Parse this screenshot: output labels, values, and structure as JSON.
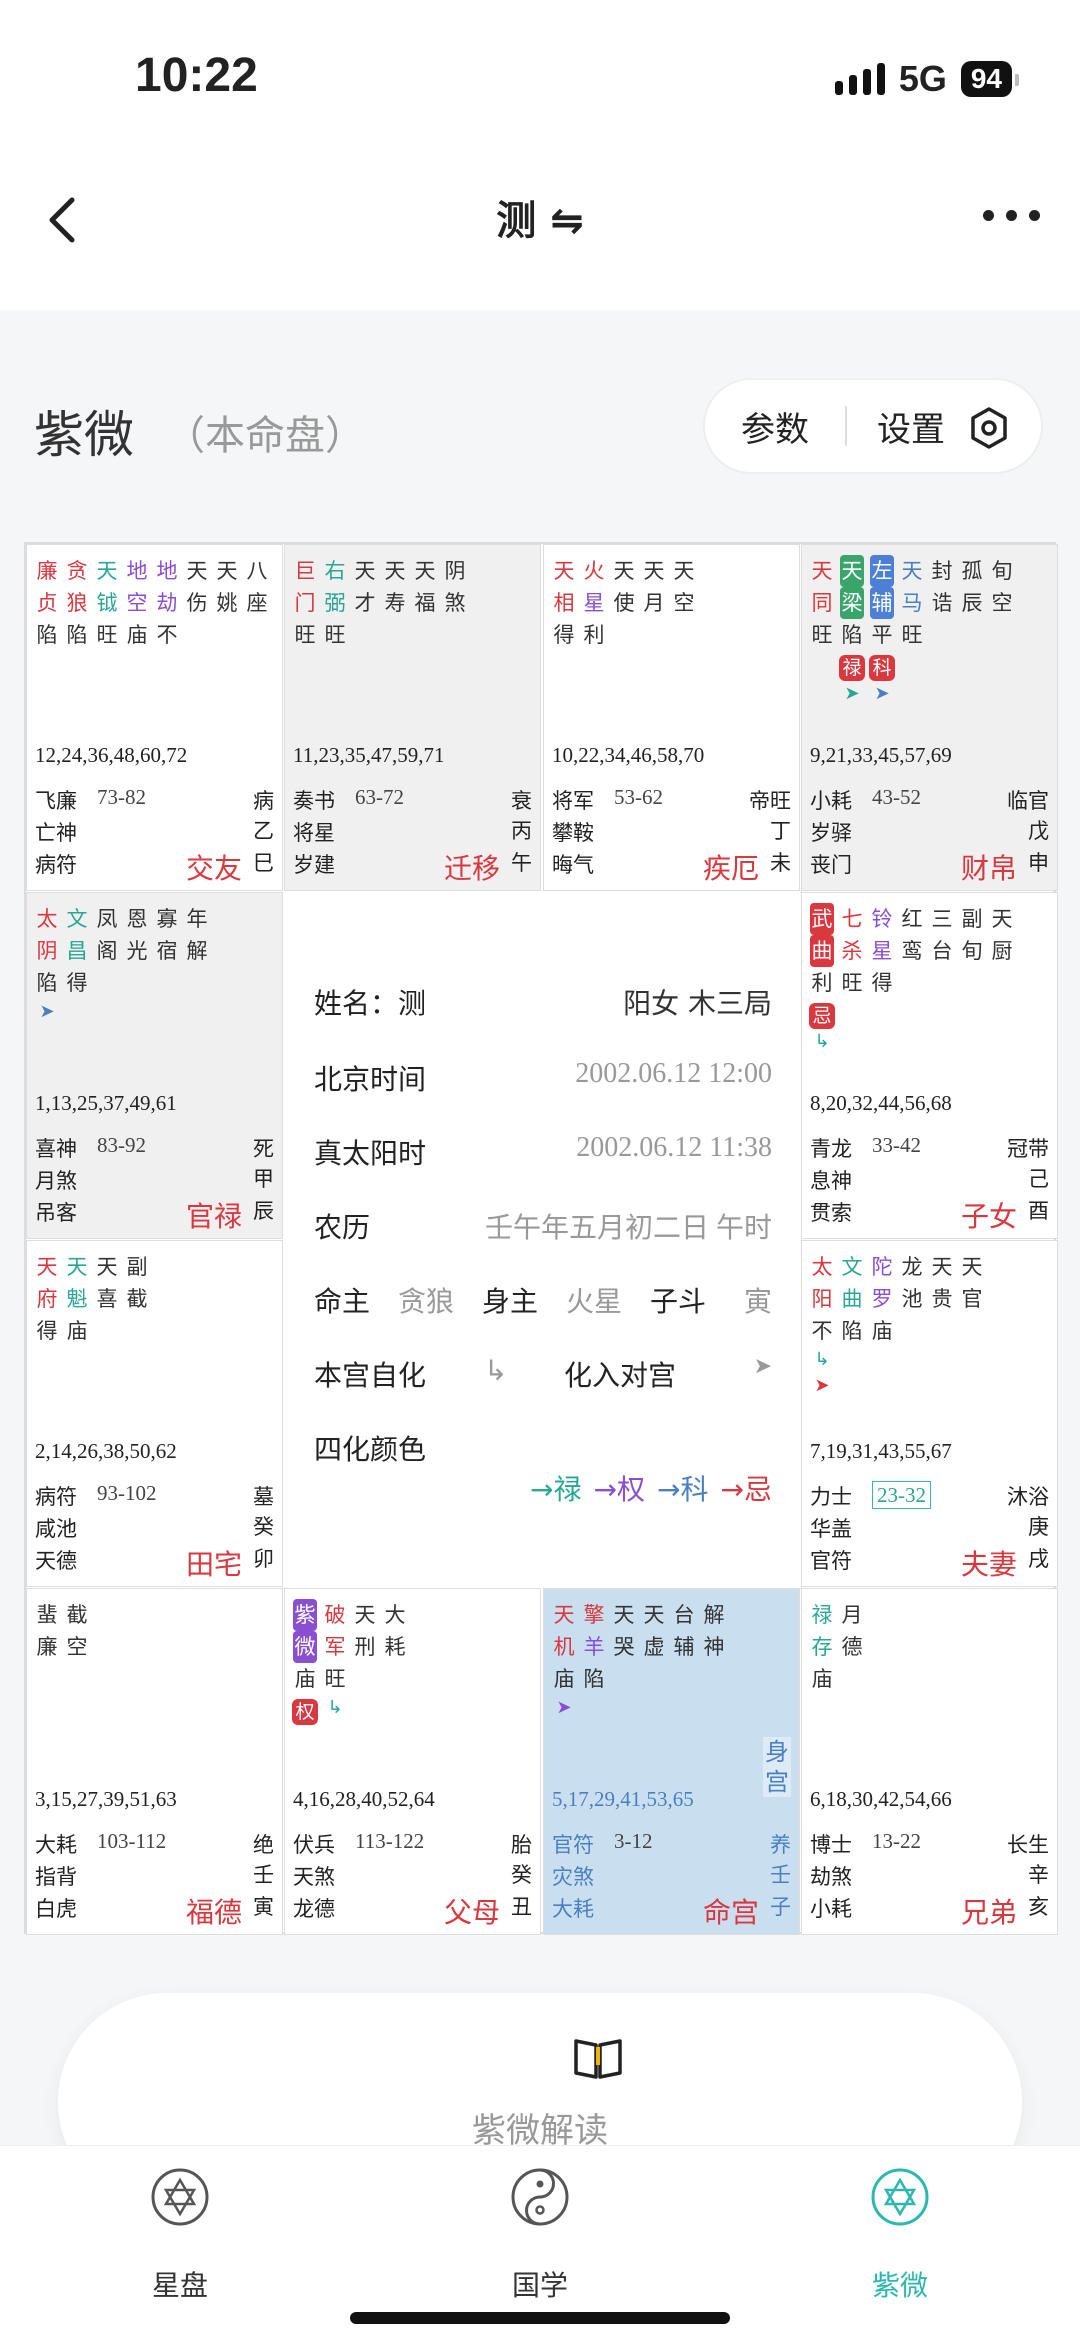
{
  "status": {
    "time": "10:22",
    "network": "5G",
    "battery": "94"
  },
  "nav": {
    "title": "测 ⇋"
  },
  "header": {
    "title": "紫微",
    "subtitle": "（本命盘）",
    "params_label": "参数",
    "settings_label": "设置"
  },
  "center": {
    "name_label": "姓名：测",
    "gender_ju": "阳女 木三局",
    "beijing_label": "北京时间",
    "beijing_value": "2002.06.12 12:00",
    "solar_label": "真太阳时",
    "solar_value": "2002.06.12 11:38",
    "lunar_label": "农历",
    "lunar_value": "壬午年五月初二日 午时",
    "ming_zhu_label": "命主",
    "ming_zhu_value": "贪狼",
    "shen_zhu_label": "身主",
    "shen_zhu_value": "火星",
    "zi_dou_label": "子斗",
    "zi_dou_value": "寅",
    "self_hua_label": "本宫自化",
    "self_hua_icon": "↳",
    "opp_hua_label": "化入对宫",
    "opp_hua_icon": "➤",
    "color_label": "四化颜色",
    "lu": "→禄",
    "quan": "→权",
    "ke": "→科",
    "ji": "→忌"
  },
  "palaces": [
    {
      "id": "si",
      "ages": "12,24,36,48,60,72",
      "l1": "飞廉",
      "range": "73-82",
      "r1": "病",
      "l2": "亡神",
      "r2": "乙",
      "l3": "病符",
      "name": "交友",
      "r3": "巳",
      "stars": [
        {
          "t": [
            "廉",
            "贞",
            "陷"
          ],
          "c": [
            "red",
            "red",
            "dark"
          ]
        },
        {
          "t": [
            "贪",
            "狼",
            "陷"
          ],
          "c": [
            "red",
            "red",
            "dark"
          ]
        },
        {
          "t": [
            "天",
            "钺",
            "旺"
          ],
          "c": [
            "green",
            "green",
            "dark"
          ]
        },
        {
          "t": [
            "地",
            "空",
            "庙"
          ],
          "c": [
            "purple",
            "purple",
            "dark"
          ]
        },
        {
          "t": [
            "地",
            "劫",
            "不"
          ],
          "c": [
            "purple",
            "purple",
            "dark"
          ]
        },
        {
          "t": [
            "天",
            "伤"
          ],
          "c": [
            "dark",
            "dark"
          ]
        },
        {
          "t": [
            "天",
            "姚"
          ],
          "c": [
            "dark",
            "dark"
          ]
        },
        {
          "t": [
            "八",
            "座"
          ],
          "c": [
            "dark",
            "dark"
          ]
        }
      ]
    },
    {
      "id": "wu",
      "ages": "11,23,35,47,59,71",
      "l1": "奏书",
      "range": "63-72",
      "r1": "衰",
      "l2": "将星",
      "r2": "丙",
      "l3": "岁建",
      "name": "迁移",
      "r3": "午",
      "stars": [
        {
          "t": [
            "巨",
            "门",
            "旺"
          ],
          "c": [
            "red",
            "red",
            "dark"
          ]
        },
        {
          "t": [
            "右",
            "弼",
            "旺"
          ],
          "c": [
            "green",
            "green",
            "dark"
          ]
        },
        {
          "t": [
            "天",
            "才"
          ],
          "c": [
            "dark",
            "dark"
          ]
        },
        {
          "t": [
            "天",
            "寿"
          ],
          "c": [
            "dark",
            "dark"
          ]
        },
        {
          "t": [
            "天",
            "福"
          ],
          "c": [
            "dark",
            "dark"
          ]
        },
        {
          "t": [
            "阴",
            "煞"
          ],
          "c": [
            "dark",
            "dark"
          ]
        }
      ]
    },
    {
      "id": "wei",
      "ages": "10,22,34,46,58,70",
      "l1": "将军",
      "range": "53-62",
      "r1": "帝旺",
      "l2": "攀鞍",
      "r2": "丁",
      "l3": "晦气",
      "name": "疾厄",
      "r3": "未",
      "stars": [
        {
          "t": [
            "天",
            "相",
            "得"
          ],
          "c": [
            "red",
            "red",
            "dark"
          ]
        },
        {
          "t": [
            "火",
            "星",
            "利"
          ],
          "c": [
            "red",
            "purple",
            "dark"
          ]
        },
        {
          "t": [
            "天",
            "使"
          ],
          "c": [
            "dark",
            "dark"
          ]
        },
        {
          "t": [
            "天",
            "月"
          ],
          "c": [
            "dark",
            "dark"
          ]
        },
        {
          "t": [
            "天",
            "空"
          ],
          "c": [
            "dark",
            "dark"
          ]
        }
      ]
    },
    {
      "id": "shen",
      "ages": "9,21,33,45,57,69",
      "l1": "小耗",
      "range": "43-52",
      "r1": "临官",
      "l2": "岁驿",
      "r2": "戊",
      "l3": "丧门",
      "name": "财帛",
      "r3": "申",
      "stars": [
        {
          "t": [
            "天",
            "同",
            "旺"
          ],
          "c": [
            "red",
            "red",
            "dark"
          ]
        },
        {
          "t": [
            "天",
            "梁",
            "陷"
          ],
          "c": [
            "box-green",
            "box-green",
            "dark"
          ],
          "hua": "禄",
          "arrow": "➤",
          "arrowc": "green"
        },
        {
          "t": [
            "左",
            "辅",
            "平"
          ],
          "c": [
            "box-blue",
            "box-blue",
            "dark"
          ],
          "hua": "科",
          "arrow": "➤",
          "arrowc": "blue"
        },
        {
          "t": [
            "天",
            "马",
            "旺"
          ],
          "c": [
            "blue",
            "blue",
            "dark"
          ]
        },
        {
          "t": [
            "封",
            "诰"
          ],
          "c": [
            "dark",
            "dark"
          ]
        },
        {
          "t": [
            "孤",
            "辰"
          ],
          "c": [
            "dark",
            "dark"
          ]
        },
        {
          "t": [
            "旬",
            "空"
          ],
          "c": [
            "dark",
            "dark"
          ]
        }
      ]
    },
    {
      "id": "chen",
      "ages": "1,13,25,37,49,61",
      "l1": "喜神",
      "range": "83-92",
      "r1": "死",
      "l2": "月煞",
      "r2": "甲",
      "l3": "吊客",
      "name": "官禄",
      "r3": "辰",
      "stars": [
        {
          "t": [
            "太",
            "阴",
            "陷"
          ],
          "c": [
            "red",
            "red",
            "dark"
          ],
          "arrow": "➤",
          "arrowc": "blue"
        },
        {
          "t": [
            "文",
            "昌",
            "得"
          ],
          "c": [
            "green",
            "green",
            "dark"
          ]
        },
        {
          "t": [
            "凤",
            "阁"
          ],
          "c": [
            "dark",
            "dark"
          ]
        },
        {
          "t": [
            "恩",
            "光"
          ],
          "c": [
            "dark",
            "dark"
          ]
        },
        {
          "t": [
            "寡",
            "宿"
          ],
          "c": [
            "dark",
            "dark"
          ]
        },
        {
          "t": [
            "年",
            "解"
          ],
          "c": [
            "dark",
            "dark"
          ]
        }
      ]
    },
    {
      "id": "you",
      "ages": "8,20,32,44,56,68",
      "l1": "青龙",
      "range": "33-42",
      "r1": "冠带",
      "l2": "息神",
      "r2": "己",
      "l3": "贯索",
      "name": "子女",
      "r3": "酉",
      "stars": [
        {
          "t": [
            "武",
            "曲",
            "利"
          ],
          "c": [
            "box-red",
            "box-red",
            "dark"
          ],
          "hua": "忌",
          "arrow": "↳",
          "arrowc": "green"
        },
        {
          "t": [
            "七",
            "杀",
            "旺"
          ],
          "c": [
            "red",
            "red",
            "dark"
          ]
        },
        {
          "t": [
            "铃",
            "星",
            "得"
          ],
          "c": [
            "purple",
            "purple",
            "dark"
          ]
        },
        {
          "t": [
            "红",
            "鸾"
          ],
          "c": [
            "dark",
            "dark"
          ]
        },
        {
          "t": [
            "三",
            "台"
          ],
          "c": [
            "dark",
            "dark"
          ]
        },
        {
          "t": [
            "副",
            "旬"
          ],
          "c": [
            "dark",
            "dark"
          ]
        },
        {
          "t": [
            "天",
            "厨"
          ],
          "c": [
            "dark",
            "dark"
          ]
        }
      ]
    },
    {
      "id": "mao",
      "ages": "2,14,26,38,50,62",
      "l1": "病符",
      "range": "93-102",
      "r1": "墓",
      "l2": "咸池",
      "r2": "癸",
      "l3": "天德",
      "name": "田宅",
      "r3": "卯",
      "stars": [
        {
          "t": [
            "天",
            "府",
            "得"
          ],
          "c": [
            "red",
            "red",
            "dark"
          ]
        },
        {
          "t": [
            "天",
            "魁",
            "庙"
          ],
          "c": [
            "green",
            "green",
            "dark"
          ]
        },
        {
          "t": [
            "天",
            "喜"
          ],
          "c": [
            "dark",
            "dark"
          ]
        },
        {
          "t": [
            "副",
            "截"
          ],
          "c": [
            "dark",
            "dark"
          ]
        }
      ]
    },
    {
      "id": "xu",
      "ages": "7,19,31,43,55,67",
      "l1": "力士",
      "range": "23-32",
      "r1": "沐浴",
      "l2": "华盖",
      "r2": "庚",
      "l3": "官符",
      "name": "夫妻",
      "r3": "戌",
      "stars": [
        {
          "t": [
            "太",
            "阳",
            "不"
          ],
          "c": [
            "red",
            "red",
            "dark"
          ],
          "arrow": "↳",
          "arrowc": "green",
          "arrow2": "➤",
          "arrow2c": "red"
        },
        {
          "t": [
            "文",
            "曲",
            "陷"
          ],
          "c": [
            "green",
            "green",
            "dark"
          ]
        },
        {
          "t": [
            "陀",
            "罗",
            "庙"
          ],
          "c": [
            "purple",
            "purple",
            "dark"
          ]
        },
        {
          "t": [
            "龙",
            "池"
          ],
          "c": [
            "dark",
            "dark"
          ]
        },
        {
          "t": [
            "天",
            "贵"
          ],
          "c": [
            "dark",
            "dark"
          ]
        },
        {
          "t": [
            "天",
            "官"
          ],
          "c": [
            "dark",
            "dark"
          ]
        }
      ]
    },
    {
      "id": "yin",
      "ages": "3,15,27,39,51,63",
      "l1": "大耗",
      "range": "103-112",
      "r1": "绝",
      "l2": "指背",
      "r2": "壬",
      "l3": "白虎",
      "name": "福德",
      "r3": "寅",
      "stars": [
        {
          "t": [
            "蜚",
            "廉"
          ],
          "c": [
            "dark",
            "dark"
          ]
        },
        {
          "t": [
            "截",
            "空"
          ],
          "c": [
            "dark",
            "dark"
          ]
        }
      ]
    },
    {
      "id": "chou",
      "ages": "4,16,28,40,52,64",
      "l1": "伏兵",
      "range": "113-122",
      "r1": "胎",
      "l2": "天煞",
      "r2": "癸",
      "l3": "龙德",
      "name": "父母",
      "r3": "丑",
      "stars": [
        {
          "t": [
            "紫",
            "微",
            "庙"
          ],
          "c": [
            "box-purple",
            "box-purple",
            "dark"
          ],
          "hua": "权"
        },
        {
          "t": [
            "破",
            "军",
            "旺"
          ],
          "c": [
            "red",
            "red",
            "dark"
          ],
          "arrow": "↳",
          "arrowc": "green"
        },
        {
          "t": [
            "天",
            "刑"
          ],
          "c": [
            "dark",
            "dark"
          ]
        },
        {
          "t": [
            "大",
            "耗"
          ],
          "c": [
            "dark",
            "dark"
          ]
        }
      ]
    },
    {
      "id": "zi",
      "ages": "5,17,29,41,53,65",
      "l1": "官符",
      "range": "3-12",
      "r1": "养",
      "l2": "灾煞",
      "r2": "壬",
      "l3": "大耗",
      "name": "命宫",
      "r3": "子",
      "shen": "身宫",
      "stars": [
        {
          "t": [
            "天",
            "机",
            "庙"
          ],
          "c": [
            "red",
            "red",
            "dark"
          ],
          "arrow": "➤",
          "arrowc": "purple"
        },
        {
          "t": [
            "擎",
            "羊",
            "陷"
          ],
          "c": [
            "red",
            "purple",
            "dark"
          ]
        },
        {
          "t": [
            "天",
            "哭"
          ],
          "c": [
            "dark",
            "dark"
          ]
        },
        {
          "t": [
            "天",
            "虚"
          ],
          "c": [
            "dark",
            "dark"
          ]
        },
        {
          "t": [
            "台",
            "辅"
          ],
          "c": [
            "dark",
            "dark"
          ]
        },
        {
          "t": [
            "解",
            "神"
          ],
          "c": [
            "dark",
            "dark"
          ]
        }
      ]
    },
    {
      "id": "hai",
      "ages": "6,18,30,42,54,66",
      "l1": "博士",
      "range": "13-22",
      "r1": "长生",
      "l2": "劫煞",
      "r2": "辛",
      "l3": "小耗",
      "name": "兄弟",
      "r3": "亥",
      "stars": [
        {
          "t": [
            "禄",
            "存",
            "庙"
          ],
          "c": [
            "green",
            "green",
            "dark"
          ]
        },
        {
          "t": [
            "月",
            "德"
          ],
          "c": [
            "dark",
            "dark"
          ]
        }
      ]
    }
  ],
  "reading_label": "紫微解读",
  "tabs": [
    {
      "label": "星盘"
    },
    {
      "label": "国学"
    },
    {
      "label": "紫微"
    }
  ]
}
